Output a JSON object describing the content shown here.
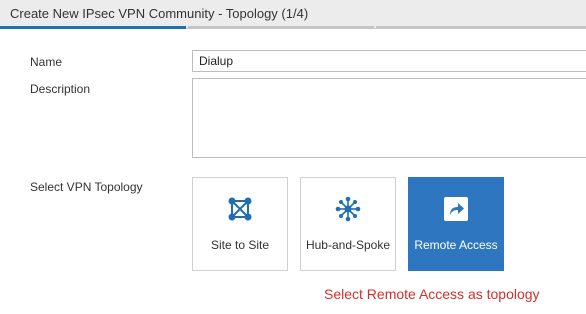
{
  "window": {
    "title": "Create New IPsec VPN Community - Topology (1/4)"
  },
  "form": {
    "name_label": "Name",
    "name_value": "Dialup",
    "description_label": "Description",
    "description_value": "",
    "topology_label": "Select VPN Topology"
  },
  "topology": {
    "options": [
      {
        "label": "Site to Site",
        "icon": "site-to-site-icon"
      },
      {
        "label": "Hub-and-Spoke",
        "icon": "hub-and-spoke-icon"
      },
      {
        "label": "Remote Access",
        "icon": "remote-access-icon",
        "selected": true
      }
    ]
  },
  "annotation": {
    "text": "Select Remote Access as topology"
  },
  "colors": {
    "accent": "#2e76bf",
    "annotation": "#d0312d",
    "progress_active": "#1f6fb5"
  }
}
